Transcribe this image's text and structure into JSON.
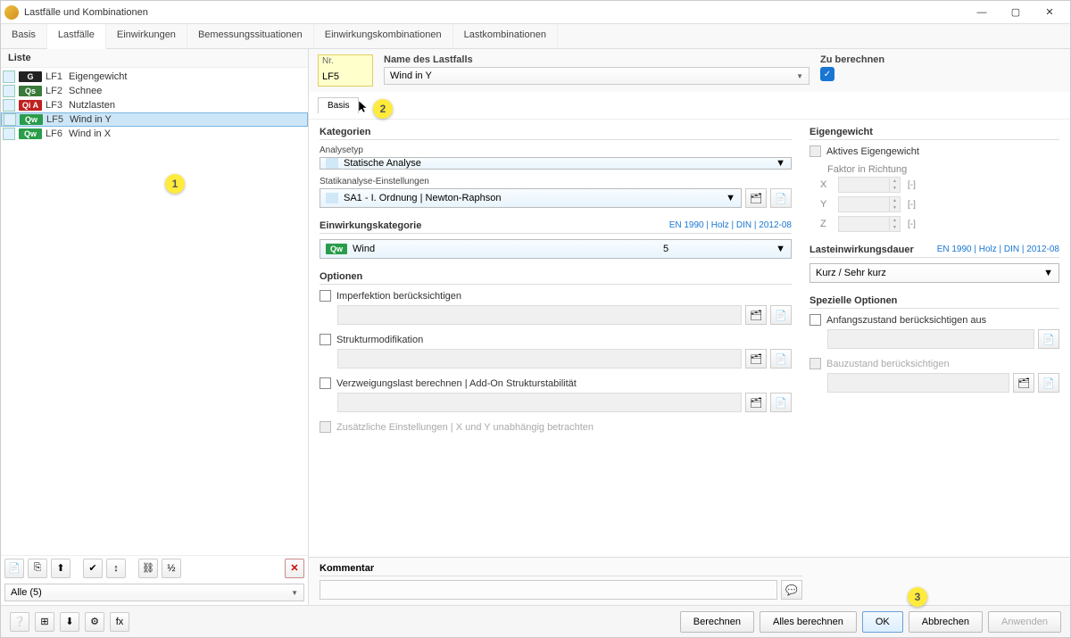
{
  "window": {
    "title": "Lastfälle und Kombinationen"
  },
  "tabs": [
    "Basis",
    "Lastfälle",
    "Einwirkungen",
    "Bemessungssituationen",
    "Einwirkungskombinationen",
    "Lastkombinationen"
  ],
  "activeTab": 1,
  "list": {
    "title": "Liste",
    "items": [
      {
        "tag": "G",
        "tagClass": "G",
        "lf": "LF1",
        "name": "Eigengewicht",
        "selected": false
      },
      {
        "tag": "Qs",
        "tagClass": "Qs",
        "lf": "LF2",
        "name": "Schnee",
        "selected": false
      },
      {
        "tag": "Qi A",
        "tagClass": "QiA",
        "lf": "LF3",
        "name": "Nutzlasten",
        "selected": false
      },
      {
        "tag": "Qw",
        "tagClass": "Qw",
        "lf": "LF5",
        "name": "Wind in Y",
        "selected": true
      },
      {
        "tag": "Qw",
        "tagClass": "Qw",
        "lf": "LF6",
        "name": "Wind in X",
        "selected": false
      }
    ],
    "filter": "Alle (5)"
  },
  "header": {
    "nr_label": "Nr.",
    "nr_value": "LF5",
    "name_label": "Name des Lastfalls",
    "name_value": "Wind in Y",
    "calc_label": "Zu berechnen"
  },
  "subtab": "Basis",
  "kategorien": {
    "title": "Kategorien",
    "analysetyp_label": "Analysetyp",
    "analysetyp_value": "Statische Analyse",
    "sae_label": "Statikanalyse-Einstellungen",
    "sae_value": "SA1 - I. Ordnung | Newton-Raphson"
  },
  "eigengewicht": {
    "title": "Eigengewicht",
    "aktiv_label": "Aktives Eigengewicht",
    "faktor_label": "Faktor in Richtung",
    "axes": [
      "X",
      "Y",
      "Z"
    ],
    "unit": "[-]"
  },
  "einwirk": {
    "title": "Einwirkungskategorie",
    "std": "EN 1990 | Holz | DIN | 2012-08",
    "tag": "Qw",
    "value": "Wind",
    "code": "5"
  },
  "lasteinw": {
    "title": "Lasteinwirkungsdauer",
    "std": "EN 1990 | Holz | DIN | 2012-08",
    "value": "Kurz / Sehr kurz"
  },
  "optionen": {
    "title": "Optionen",
    "items": [
      {
        "label": "Imperfektion berücksichtigen",
        "checked": false,
        "enabled": true
      },
      {
        "label": "Strukturmodifikation",
        "checked": false,
        "enabled": true
      },
      {
        "label": "Verzweigungslast berechnen | Add-On Strukturstabilität",
        "checked": false,
        "enabled": true
      },
      {
        "label": "Zusätzliche Einstellungen | X und Y unabhängig betrachten",
        "checked": false,
        "enabled": false
      }
    ]
  },
  "spez": {
    "title": "Spezielle Optionen",
    "items": [
      {
        "label": "Anfangszustand berücksichtigen aus",
        "checked": false,
        "enabled": true
      },
      {
        "label": "Bauzustand berücksichtigen",
        "checked": false,
        "enabled": false
      }
    ]
  },
  "kommentar": {
    "title": "Kommentar"
  },
  "footer": {
    "berechnen": "Berechnen",
    "alles": "Alles berechnen",
    "ok": "OK",
    "abbrechen": "Abbrechen",
    "anwenden": "Anwenden"
  },
  "annotations": {
    "a1": "1",
    "a2": "2",
    "a3": "3"
  }
}
